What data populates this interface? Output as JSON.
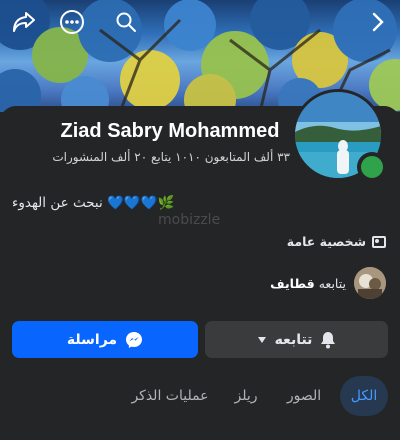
{
  "header": {
    "share_icon": "share-icon",
    "more_icon": "more-dots-icon",
    "search_icon": "search-icon",
    "next_icon": "chevron-right-icon"
  },
  "profile": {
    "name": "Ziad Sabry Mohammed",
    "stats": "٣٣ ألف المتابعون ١٠١٠ يتابع ٢٠ ألف المنشورات",
    "bio": "نبحث عن الهدوء 💙💙💙🌿",
    "category": "شخصية عامة",
    "follows_label": "يتابعه",
    "follows_name": "قطايف",
    "online_color": "#31a24c"
  },
  "watermark": "mobizzle",
  "actions": {
    "message_label": "مراسلة",
    "follow_label": "تتابعه",
    "accent": "#0866ff"
  },
  "tabs": [
    {
      "label": "الكل",
      "active": true
    },
    {
      "label": "الصور",
      "active": false
    },
    {
      "label": "ريلز",
      "active": false
    },
    {
      "label": "عمليات الذكر",
      "active": false
    }
  ]
}
